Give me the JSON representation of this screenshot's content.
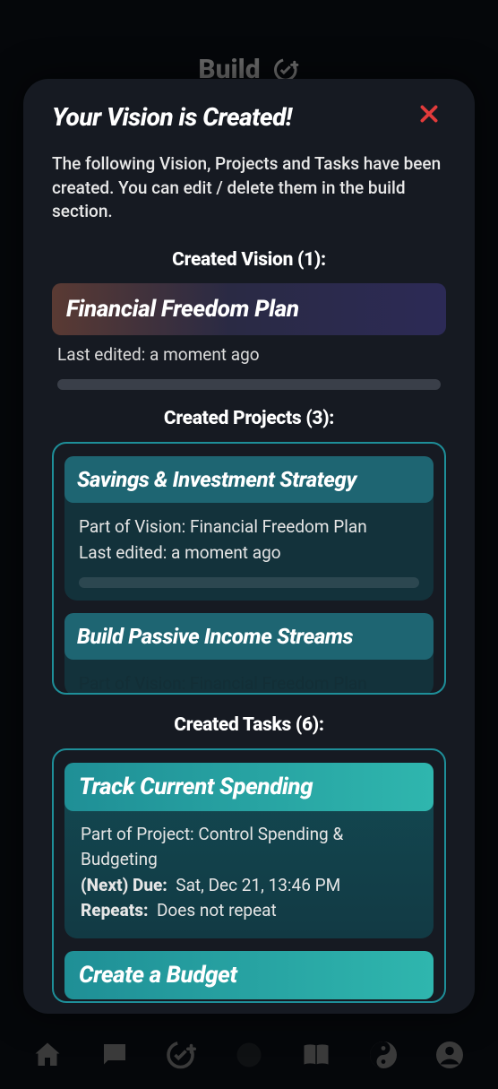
{
  "header": {
    "title": "Build"
  },
  "modal": {
    "title": "Your Vision is Created!",
    "intro": "The following Vision, Projects and Tasks have been created. You can edit / delete them in the build section."
  },
  "vision_section": {
    "label": "Created Vision (1):",
    "count": 1,
    "items": [
      {
        "title": "Financial Freedom Plan",
        "last_edited": "Last edited: a moment ago"
      }
    ]
  },
  "projects_section": {
    "label": "Created Projects (3):",
    "count": 3,
    "items": [
      {
        "title": "Savings & Investment Strategy",
        "part_of": "Part of Vision: Financial Freedom Plan",
        "last_edited": "Last edited: a moment ago"
      },
      {
        "title": "Build Passive Income Streams",
        "part_of": "Part of Vision: Financial Freedom Plan"
      }
    ]
  },
  "tasks_section": {
    "label": "Created Tasks (6):",
    "count": 6,
    "items": [
      {
        "title": "Track Current Spending",
        "part_of": "Part of Project: Control Spending & Budgeting",
        "due_label": "(Next) Due:",
        "due_value": "Sat, Dec 21, 13:46 PM",
        "repeats_label": "Repeats:",
        "repeats_value": "Does not repeat"
      },
      {
        "title": "Create a Budget"
      }
    ]
  },
  "nav": {
    "items": [
      "home",
      "chat",
      "check-add",
      "book",
      "yinyang",
      "profile"
    ]
  }
}
